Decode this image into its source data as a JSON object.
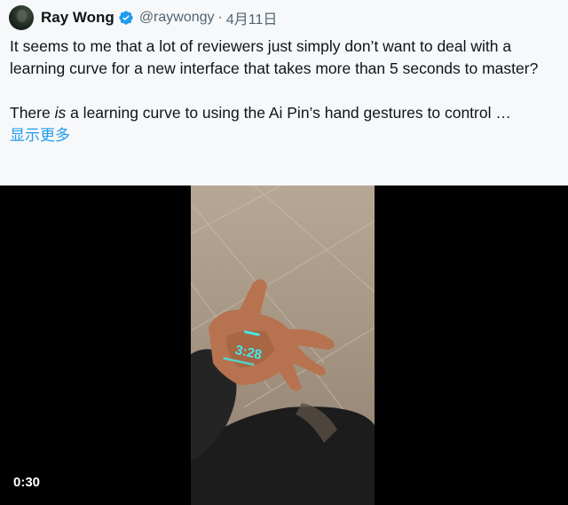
{
  "tweet": {
    "author_name": "Ray Wong",
    "handle": "@raywongy",
    "separator": "·",
    "date": "4月11日",
    "text_para1": "It seems to me that a lot of reviewers just simply don’t want to deal with a learning curve for a new interface that takes more than 5 seconds to master?",
    "text_para2_before": "There ",
    "text_para2_em": "is",
    "text_para2_after": " a learning curve to using the Ai Pin’s hand gestures to control …",
    "show_more": "显示更多"
  },
  "media": {
    "duration": "0:30",
    "projected_time": "3:28"
  },
  "colors": {
    "link": "#1d9bf0",
    "secondary_text": "#536471",
    "verified_badge": "#1d9bf0",
    "projection": "#3ff0f0"
  },
  "icons": {
    "verified": "verified-badge-icon",
    "avatar": "avatar"
  }
}
